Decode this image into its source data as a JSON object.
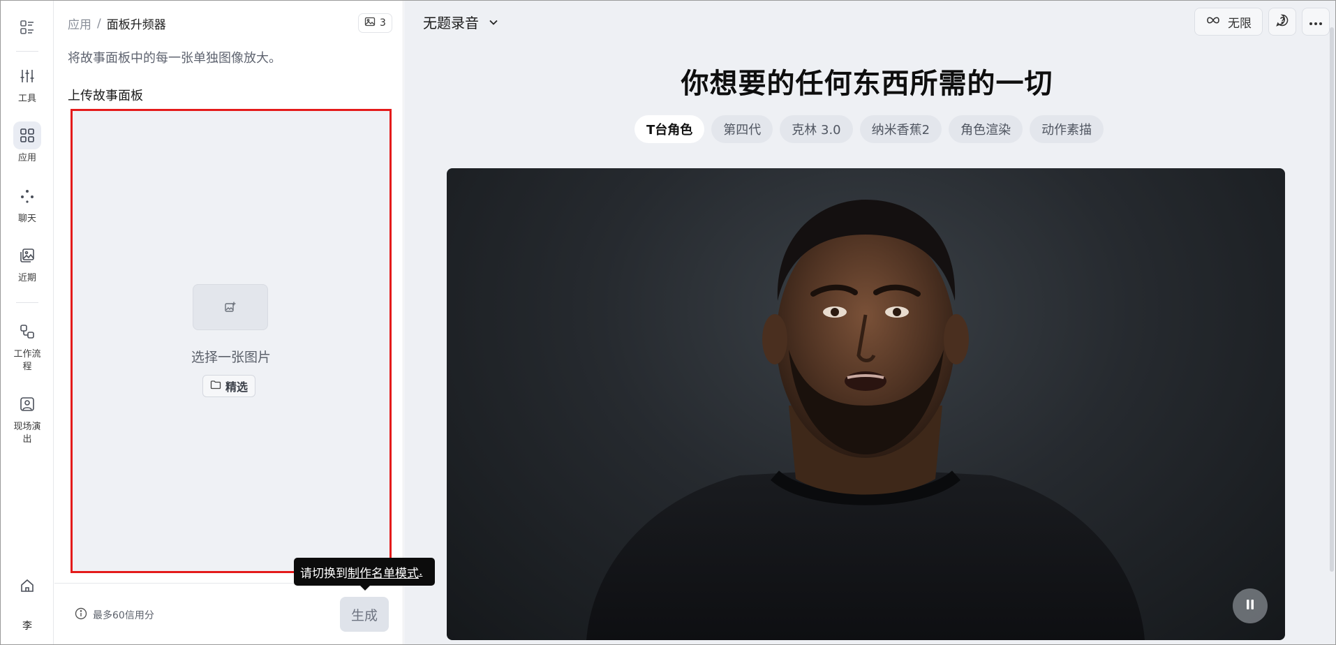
{
  "rail": {
    "items": [
      {
        "name": "tools",
        "label": "工具",
        "icon": "sliders-icon"
      },
      {
        "name": "apps",
        "label": "应用",
        "icon": "grid-icon",
        "active": true
      },
      {
        "name": "chat",
        "label": "聊天",
        "icon": "dots-icon"
      },
      {
        "name": "recent",
        "label": "近期",
        "icon": "images-icon"
      },
      {
        "name": "workflow",
        "label": "工作流程",
        "icon": "workflow-icon"
      },
      {
        "name": "live",
        "label": "现场演出",
        "icon": "portrait-icon"
      }
    ],
    "avatar": "李"
  },
  "panel": {
    "breadcrumb_root": "应用",
    "breadcrumb_sep": "/",
    "breadcrumb_current": "面板升频器",
    "image_count": "3",
    "description": "将故事面板中的每一张单独图像放大。",
    "upload_title": "上传故事面板",
    "dropzone_text": "选择一张图片",
    "pick_button": "精选",
    "credits": "最多60信用分",
    "generate": "生成",
    "tooltip_prefix": "请切换到",
    "tooltip_link": "制作名单模式",
    "tooltip_suffix": "."
  },
  "main": {
    "recording_title": "无题录音",
    "unlimited": "无限",
    "headline": "你想要的任何东西所需的一切",
    "chips": [
      "T台角色",
      "第四代",
      "克林 3.0",
      "纳米香蕉2",
      "角色渲染",
      "动作素描"
    ],
    "active_chip": 0
  },
  "colors": {
    "accent_red": "#e41b1b",
    "main_bg": "#eef0f4",
    "chip_bg": "#e3e6ec"
  }
}
